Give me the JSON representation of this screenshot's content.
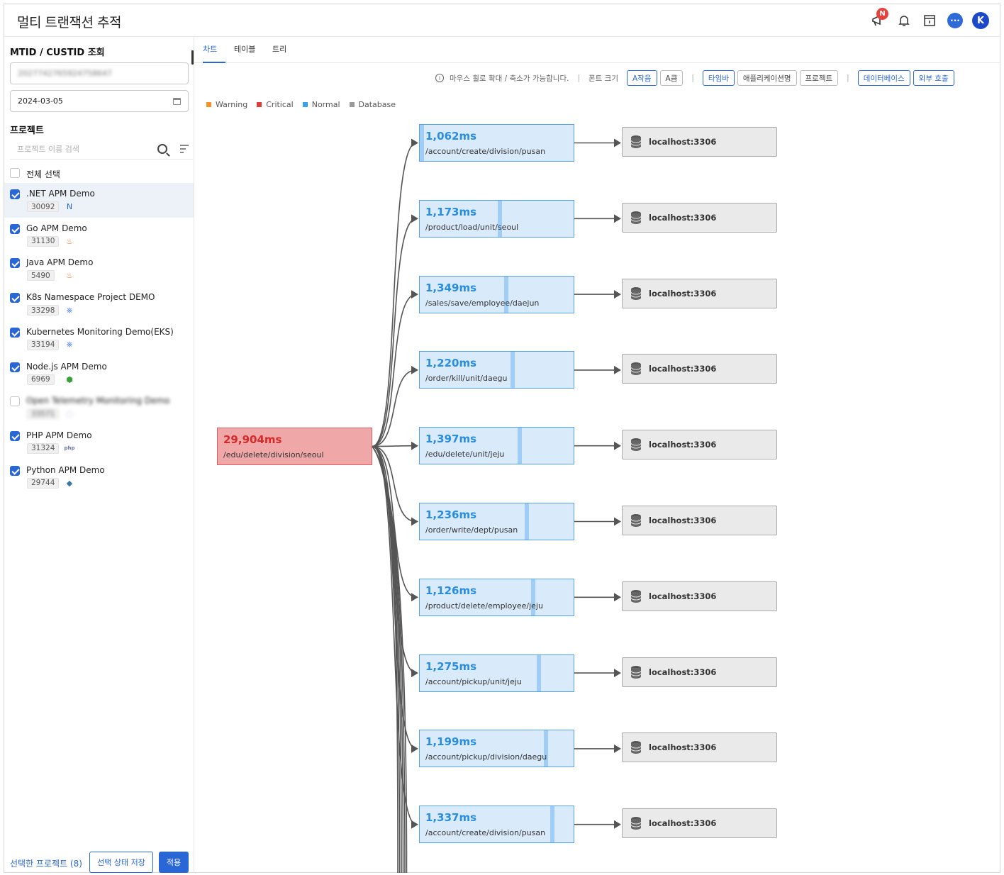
{
  "header": {
    "title": "멀티 트랜잭션 추적",
    "notice_badge": "N",
    "chat_label": "···",
    "avatar_letter": "K"
  },
  "sidebar": {
    "mtid_title": "MTID / CUSTID 조회",
    "mtid_value": "2027742765924758647",
    "date_value": "2024-03-05",
    "project_title": "프로젝트",
    "search_placeholder": "프로젝트 이름 검색",
    "select_all_label": "전체 선택",
    "projects": [
      {
        "name": ".NET APM Demo",
        "id": "30092",
        "icon": "dotnet-icon",
        "glyph": "ꓠ",
        "color": "#2a67d6",
        "checked": true,
        "selected": true
      },
      {
        "name": "Go APM Demo",
        "id": "31130",
        "icon": "java-icon",
        "glyph": "♨",
        "color": "#e8792a",
        "checked": true
      },
      {
        "name": "Java APM Demo",
        "id": "5490",
        "icon": "java-icon",
        "glyph": "♨",
        "color": "#e8792a",
        "checked": true
      },
      {
        "name": "K8s Namespace Project DEMO",
        "id": "33298",
        "icon": "kubernetes-icon",
        "glyph": "⎈",
        "color": "#326ce5",
        "checked": true
      },
      {
        "name": "Kubernetes Monitoring Demo(EKS)",
        "id": "33194",
        "icon": "kubernetes-icon",
        "glyph": "⎈",
        "color": "#326ce5",
        "checked": true
      },
      {
        "name": "Node.js APM Demo",
        "id": "6969",
        "icon": "nodejs-icon",
        "glyph": "⬢",
        "color": "#3c9e3c",
        "checked": true
      },
      {
        "name": "Open Telemetry Monitoring Demo",
        "id": "33571",
        "icon": "otel-icon",
        "glyph": "◌",
        "color": "#8a8ad8",
        "checked": false,
        "blurred": true
      },
      {
        "name": "PHP APM Demo",
        "id": "31324",
        "icon": "php-icon",
        "glyph": "php",
        "color": "#6a72a8",
        "checked": true
      },
      {
        "name": "Python APM Demo",
        "id": "29744",
        "icon": "python-icon",
        "glyph": "◆",
        "color": "#3b77a8",
        "checked": true
      }
    ],
    "selected_projects_label": "선택한 프로젝트 (8)",
    "save_button": "선택 상태 저장",
    "apply_button": "적용"
  },
  "tabs": [
    {
      "label": "차트",
      "active": true
    },
    {
      "label": "테이블"
    },
    {
      "label": "트리"
    }
  ],
  "toolbar": {
    "info_text": "마우스 휠로 확대 / 축소가 가능합니다.",
    "font_size_label": "폰트 크기",
    "font_small": "A작음",
    "font_large": "A큼",
    "timebar": "타임바",
    "app_name": "애플리케이션명",
    "project": "프로젝트",
    "database": "데이터베이스",
    "external_call": "외부 호출"
  },
  "legend": [
    {
      "label": "Warning",
      "color": "#f5922a"
    },
    {
      "label": "Critical",
      "color": "#e03a3a"
    },
    {
      "label": "Normal",
      "color": "#3aa0ea"
    },
    {
      "label": "Database",
      "color": "#9a9a9a"
    }
  ],
  "graph": {
    "root": {
      "ms": "29,904ms",
      "path": "/edu/delete/division/seoul",
      "status": "critical"
    },
    "children": [
      {
        "ms": "1,062ms",
        "path": "/account/create/division/pusan",
        "db": "localhost:3306",
        "timebar": 0.0
      },
      {
        "ms": "1,173ms",
        "path": "/product/load/unit/seoul",
        "db": "localhost:3306",
        "timebar": 0.5
      },
      {
        "ms": "1,349ms",
        "path": "/sales/save/employee/daejun",
        "db": "localhost:3306",
        "timebar": 0.545
      },
      {
        "ms": "1,220ms",
        "path": "/order/kill/unit/daegu",
        "db": "localhost:3306",
        "timebar": 0.585
      },
      {
        "ms": "1,397ms",
        "path": "/edu/delete/unit/jeju",
        "db": "localhost:3306",
        "timebar": 0.63
      },
      {
        "ms": "1,236ms",
        "path": "/order/write/dept/pusan",
        "db": "localhost:3306",
        "timebar": 0.675
      },
      {
        "ms": "1,126ms",
        "path": "/product/delete/employee/jeju",
        "db": "localhost:3306",
        "timebar": 0.715
      },
      {
        "ms": "1,275ms",
        "path": "/account/pickup/unit/jeju",
        "db": "localhost:3306",
        "timebar": 0.755
      },
      {
        "ms": "1,199ms",
        "path": "/account/pickup/division/daegu",
        "db": "localhost:3306",
        "timebar": 0.8
      },
      {
        "ms": "1,337ms",
        "path": "/account/create/division/pusan",
        "db": "localhost:3306",
        "timebar": 0.84
      }
    ]
  }
}
